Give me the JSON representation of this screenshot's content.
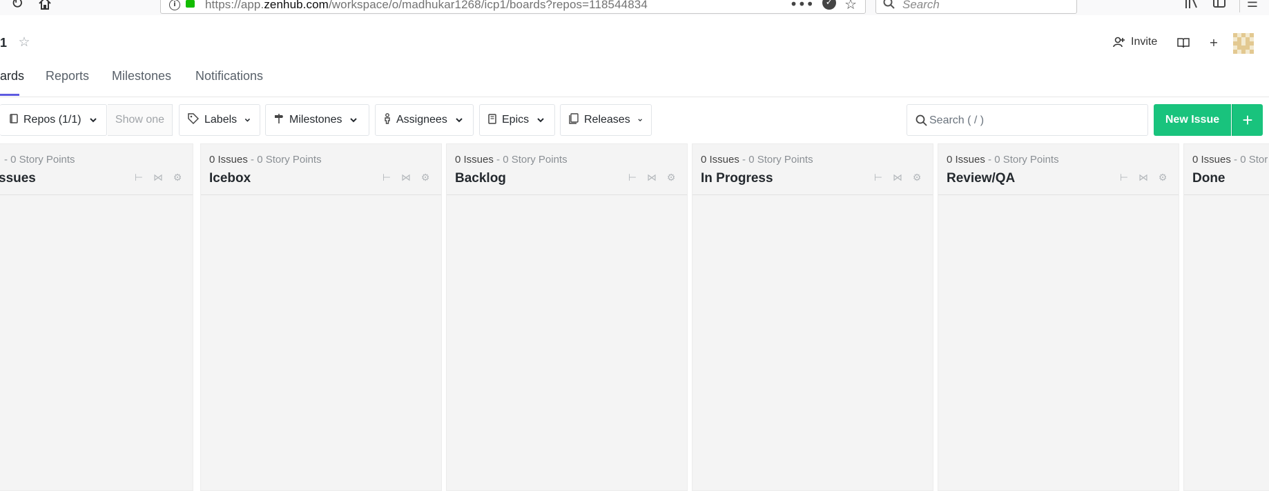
{
  "browser": {
    "url_prefix": "https://app.",
    "url_host": "zenhub.com",
    "url_path": "/workspace/o/madhukar1268/icp1/boards?repos=118544834",
    "search_placeholder": "Search"
  },
  "header": {
    "workspace_title": "1",
    "invite_label": "Invite"
  },
  "tabs": [
    {
      "label": "ards"
    },
    {
      "label": "Reports"
    },
    {
      "label": "Milestones"
    },
    {
      "label": "Notifications"
    }
  ],
  "filters": {
    "repos_label": "Repos (1/1)",
    "show_one_label": "Show one",
    "labels_label": "Labels",
    "milestones_label": "Milestones",
    "assignees_label": "Assignees",
    "epics_label": "Epics",
    "releases_label": "Releases",
    "search_placeholder": "Search ( / )",
    "new_issue_label": "New Issue",
    "new_issue_plus": "+"
  },
  "pipelines": [
    {
      "issues": "",
      "separator": "- ",
      "points": "0 Story Points",
      "name": "ssues"
    },
    {
      "issues": "0 Issues",
      "separator": " - ",
      "points": "0 Story Points",
      "name": "Icebox"
    },
    {
      "issues": "0 Issues",
      "separator": " - ",
      "points": "0 Story Points",
      "name": "Backlog"
    },
    {
      "issues": "0 Issues",
      "separator": " - ",
      "points": "0 Story Points",
      "name": "In Progress"
    },
    {
      "issues": "0 Issues",
      "separator": " - ",
      "points": "0 Story Points",
      "name": "Review/QA"
    },
    {
      "issues": "0 Issues",
      "separator": " - ",
      "points": "0 Stor",
      "name": "Done"
    }
  ],
  "colors": {
    "accent": "#5d5ae0",
    "new_issue": "#19c37d",
    "pipeline_bg": "#f4f4f4"
  }
}
